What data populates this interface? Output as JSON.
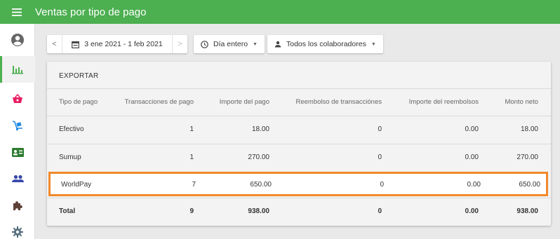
{
  "header": {
    "title": "Ventas por tipo de pago"
  },
  "toolbar": {
    "prev_label": "<",
    "next_label": ">",
    "date_range": "3 ene 2021 - 1 feb 2021",
    "time_filter": "Día entero",
    "staff_filter": "Todos los colaboradores"
  },
  "sidebar": {
    "items": [
      {
        "icon": "account-circle-icon"
      },
      {
        "icon": "bar-chart-icon",
        "active": true
      },
      {
        "icon": "basket-icon",
        "color": "#e91e63"
      },
      {
        "icon": "hand-truck-icon",
        "color": "#1e88e5"
      },
      {
        "icon": "id-card-icon",
        "color": "#2e7d32"
      },
      {
        "icon": "people-icon",
        "color": "#3949ab"
      },
      {
        "icon": "puzzle-icon",
        "color": "#5d4037"
      },
      {
        "icon": "gear-icon",
        "color": "#546e7a"
      }
    ]
  },
  "report": {
    "export_label": "EXPORTAR",
    "columns": [
      "Tipo de pago",
      "Transacciones de pago",
      "Importe del pago",
      "Reembolso de transacciónes",
      "Importe del reembolsos",
      "Monto neto"
    ],
    "rows": [
      [
        "Efectivo",
        "1",
        "18.00",
        "0",
        "0.00",
        "18.00"
      ],
      [
        "Sumup",
        "1",
        "270.00",
        "0",
        "0.00",
        "270.00"
      ],
      [
        "WorldPay",
        "7",
        "650.00",
        "0",
        "0.00",
        "650.00"
      ]
    ],
    "total": [
      "Total",
      "9",
      "938.00",
      "0",
      "0.00",
      "938.00"
    ]
  },
  "colors": {
    "brand": "#4caf50",
    "highlight": "#f08a2c"
  }
}
